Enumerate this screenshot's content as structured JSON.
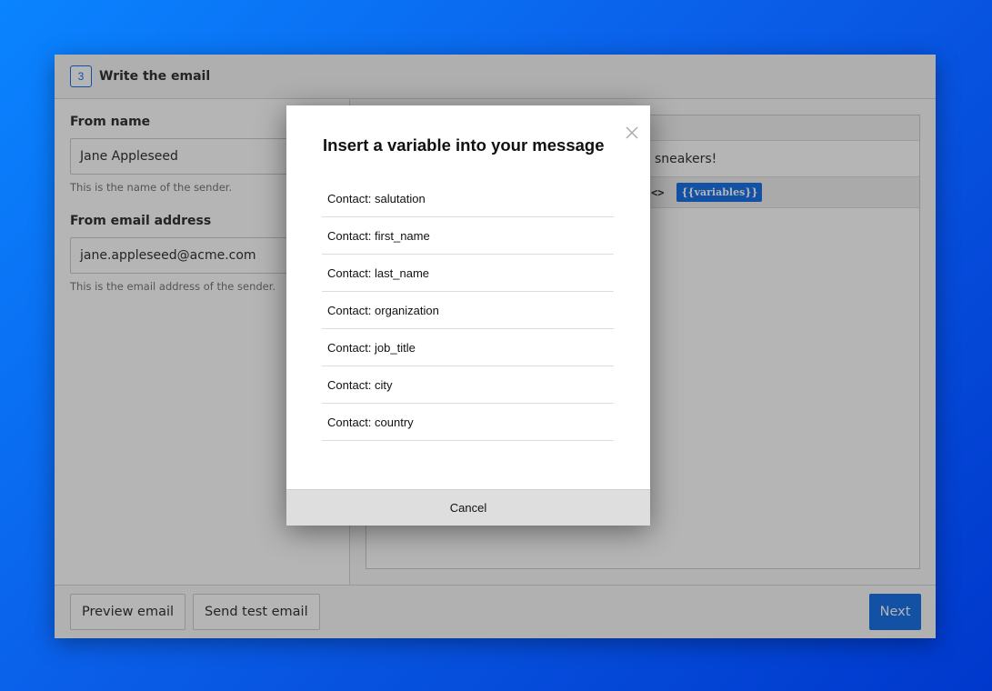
{
  "step": {
    "number": "3",
    "title": "Write the email"
  },
  "form": {
    "from_name": {
      "label": "From name",
      "value": "Jane Appleseed",
      "help": "This is the name of the sender."
    },
    "from_email": {
      "label": "From email address",
      "value": "jane.appleseed@acme.com",
      "help": "This is the email address of the sender."
    }
  },
  "editor": {
    "subject_visible": "sneakers!",
    "code_label": "<>",
    "variables_label": "{{variables}}"
  },
  "footer": {
    "preview_label": "Preview email",
    "send_test_label": "Send test email",
    "next_label": "Next"
  },
  "modal": {
    "title": "Insert a variable into your message",
    "close_icon": "close-icon",
    "variables": [
      "Contact: salutation",
      "Contact: first_name",
      "Contact: last_name",
      "Contact: organization",
      "Contact: job_title",
      "Contact: city",
      "Contact: country"
    ],
    "cancel_label": "Cancel"
  },
  "colors": {
    "primary": "#1a73e8",
    "background_start": "#0a84ff",
    "background_end": "#0038cc"
  }
}
